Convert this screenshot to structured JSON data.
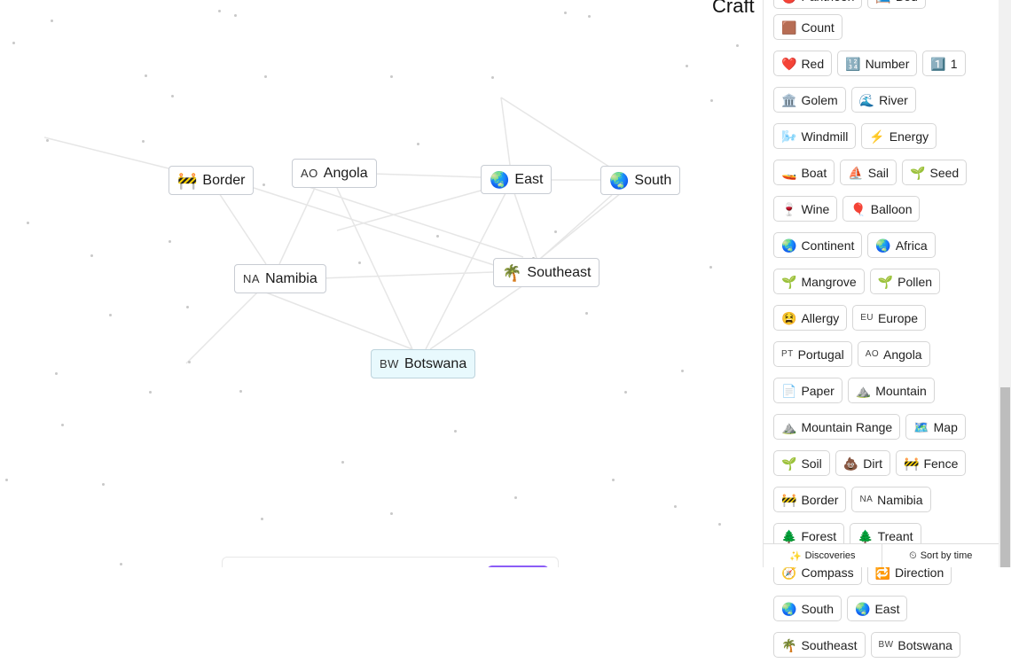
{
  "header": {
    "title": "Craft"
  },
  "canvas": {
    "nodes": [
      {
        "id": "border",
        "label": "Border",
        "emoji": "🚧",
        "code": ""
      },
      {
        "id": "angola",
        "label": "Angola",
        "emoji": "",
        "code": "AO"
      },
      {
        "id": "east",
        "label": "East",
        "emoji": "🌏",
        "code": ""
      },
      {
        "id": "south",
        "label": "South",
        "emoji": "🌏",
        "code": ""
      },
      {
        "id": "namibia",
        "label": "Namibia",
        "emoji": "",
        "code": "NA"
      },
      {
        "id": "southeast",
        "label": "Southeast",
        "emoji": "🌴",
        "code": ""
      },
      {
        "id": "botswana",
        "label": "Botswana",
        "emoji": "",
        "code": "BW",
        "new": true
      }
    ]
  },
  "sidebar": {
    "items": [
      {
        "label": "Pantheon",
        "emoji": "🔴",
        "code": ""
      },
      {
        "label": "Bed",
        "emoji": "🛏️",
        "code": ""
      },
      {
        "label": "Count",
        "emoji": "🟫",
        "code": ""
      },
      {
        "label": "Red",
        "emoji": "❤️",
        "code": ""
      },
      {
        "label": "Number",
        "emoji": "🔢",
        "code": ""
      },
      {
        "label": "1",
        "emoji": "1️⃣",
        "code": ""
      },
      {
        "label": "Golem",
        "emoji": "🏛️",
        "code": ""
      },
      {
        "label": "River",
        "emoji": "🌊",
        "code": ""
      },
      {
        "label": "Windmill",
        "emoji": "🌬️",
        "code": ""
      },
      {
        "label": "Energy",
        "emoji": "⚡",
        "code": ""
      },
      {
        "label": "Boat",
        "emoji": "🚤",
        "code": ""
      },
      {
        "label": "Sail",
        "emoji": "⛵",
        "code": ""
      },
      {
        "label": "Seed",
        "emoji": "🌱",
        "code": ""
      },
      {
        "label": "Wine",
        "emoji": "🍷",
        "code": ""
      },
      {
        "label": "Balloon",
        "emoji": "🎈",
        "code": ""
      },
      {
        "label": "Continent",
        "emoji": "🌏",
        "code": ""
      },
      {
        "label": "Africa",
        "emoji": "🌏",
        "code": ""
      },
      {
        "label": "Mangrove",
        "emoji": "🌱",
        "code": ""
      },
      {
        "label": "Pollen",
        "emoji": "🌱",
        "code": ""
      },
      {
        "label": "Allergy",
        "emoji": "😫",
        "code": ""
      },
      {
        "label": "Europe",
        "emoji": "",
        "code": "EU"
      },
      {
        "label": "Portugal",
        "emoji": "",
        "code": "PT"
      },
      {
        "label": "Angola",
        "emoji": "",
        "code": "AO"
      },
      {
        "label": "Paper",
        "emoji": "📄",
        "code": ""
      },
      {
        "label": "Mountain",
        "emoji": "⛰️",
        "code": ""
      },
      {
        "label": "Mountain Range",
        "emoji": "⛰️",
        "code": ""
      },
      {
        "label": "Map",
        "emoji": "🗺️",
        "code": ""
      },
      {
        "label": "Soil",
        "emoji": "🌱",
        "code": ""
      },
      {
        "label": "Dirt",
        "emoji": "💩",
        "code": ""
      },
      {
        "label": "Fence",
        "emoji": "🚧",
        "code": ""
      },
      {
        "label": "Border",
        "emoji": "🚧",
        "code": ""
      },
      {
        "label": "Namibia",
        "emoji": "",
        "code": "NA"
      },
      {
        "label": "Forest",
        "emoji": "🌲",
        "code": ""
      },
      {
        "label": "Treant",
        "emoji": "🌲",
        "code": ""
      },
      {
        "label": "Compass",
        "emoji": "🧭",
        "code": ""
      },
      {
        "label": "Direction",
        "emoji": "🔁",
        "code": ""
      },
      {
        "label": "South",
        "emoji": "🌏",
        "code": ""
      },
      {
        "label": "East",
        "emoji": "🌏",
        "code": ""
      },
      {
        "label": "Southeast",
        "emoji": "🌴",
        "code": ""
      },
      {
        "label": "Botswana",
        "emoji": "",
        "code": "BW"
      }
    ],
    "footer": {
      "discoveries_label": "Discoveries",
      "discoveries_icon": "✨",
      "sort_label": "Sort by time",
      "sort_icon": "⏲"
    }
  }
}
